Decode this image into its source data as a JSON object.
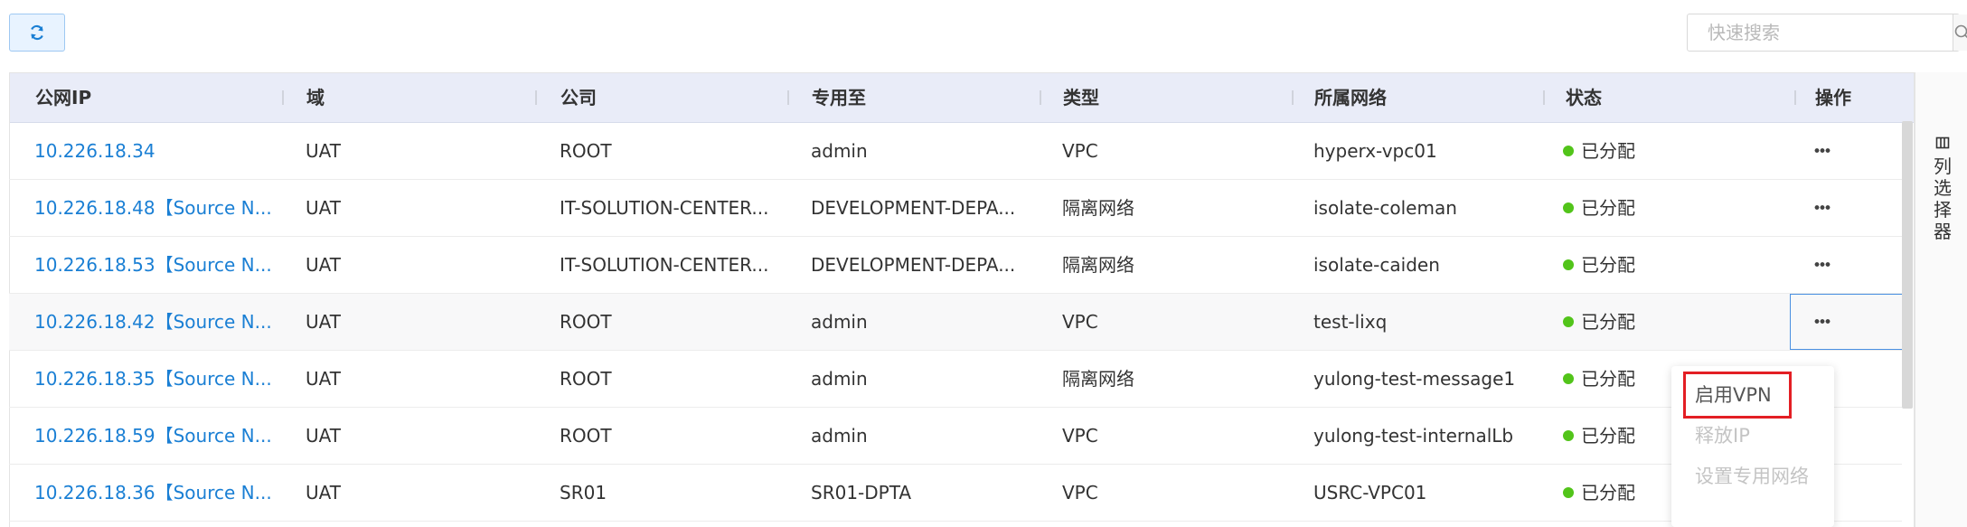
{
  "toolbar": {
    "refresh_icon": "refresh-icon",
    "search_placeholder": "快速搜索",
    "search_icon": "search-icon"
  },
  "columns": [
    "公网IP",
    "域",
    "公司",
    "专用至",
    "类型",
    "所属网络",
    "状态",
    "操作"
  ],
  "rows": [
    {
      "ip": "10.226.18.34",
      "domain": "UAT",
      "company": "ROOT",
      "dedicated": "admin",
      "type": "VPC",
      "network": "hyperx-vpc01",
      "status": "已分配"
    },
    {
      "ip": "10.226.18.48【Source N...",
      "domain": "UAT",
      "company": "IT-SOLUTION-CENTER...",
      "dedicated": "DEVELOPMENT-DEPA...",
      "type": "隔离网络",
      "network": "isolate-coleman",
      "status": "已分配"
    },
    {
      "ip": "10.226.18.53【Source N...",
      "domain": "UAT",
      "company": "IT-SOLUTION-CENTER...",
      "dedicated": "DEVELOPMENT-DEPA...",
      "type": "隔离网络",
      "network": "isolate-caiden",
      "status": "已分配"
    },
    {
      "ip": "10.226.18.42【Source N...",
      "domain": "UAT",
      "company": "ROOT",
      "dedicated": "admin",
      "type": "VPC",
      "network": "test-lixq",
      "status": "已分配"
    },
    {
      "ip": "10.226.18.35【Source N...",
      "domain": "UAT",
      "company": "ROOT",
      "dedicated": "admin",
      "type": "隔离网络",
      "network": "yulong-test-message1",
      "status": "已分配"
    },
    {
      "ip": "10.226.18.59【Source N...",
      "domain": "UAT",
      "company": "ROOT",
      "dedicated": "admin",
      "type": "VPC",
      "network": "yulong-test-internalLb",
      "status": "已分配"
    },
    {
      "ip": "10.226.18.36【Source N...",
      "domain": "UAT",
      "company": "SR01",
      "dedicated": "SR01-DPTA",
      "type": "VPC",
      "network": "USRC-VPC01",
      "status": "已分配"
    }
  ],
  "column_chooser": {
    "label": "列选择器",
    "icon": "columns-icon"
  },
  "ops_menu": {
    "items": [
      {
        "label": "启用VPN",
        "enabled": true
      },
      {
        "label": "释放IP",
        "enabled": false
      },
      {
        "label": "设置专用网络",
        "enabled": false
      }
    ]
  },
  "colors": {
    "link": "#1a7fd4",
    "status_ok": "#52c41a",
    "highlight": "#e31e24",
    "header_bg": "#e9ecf8"
  }
}
